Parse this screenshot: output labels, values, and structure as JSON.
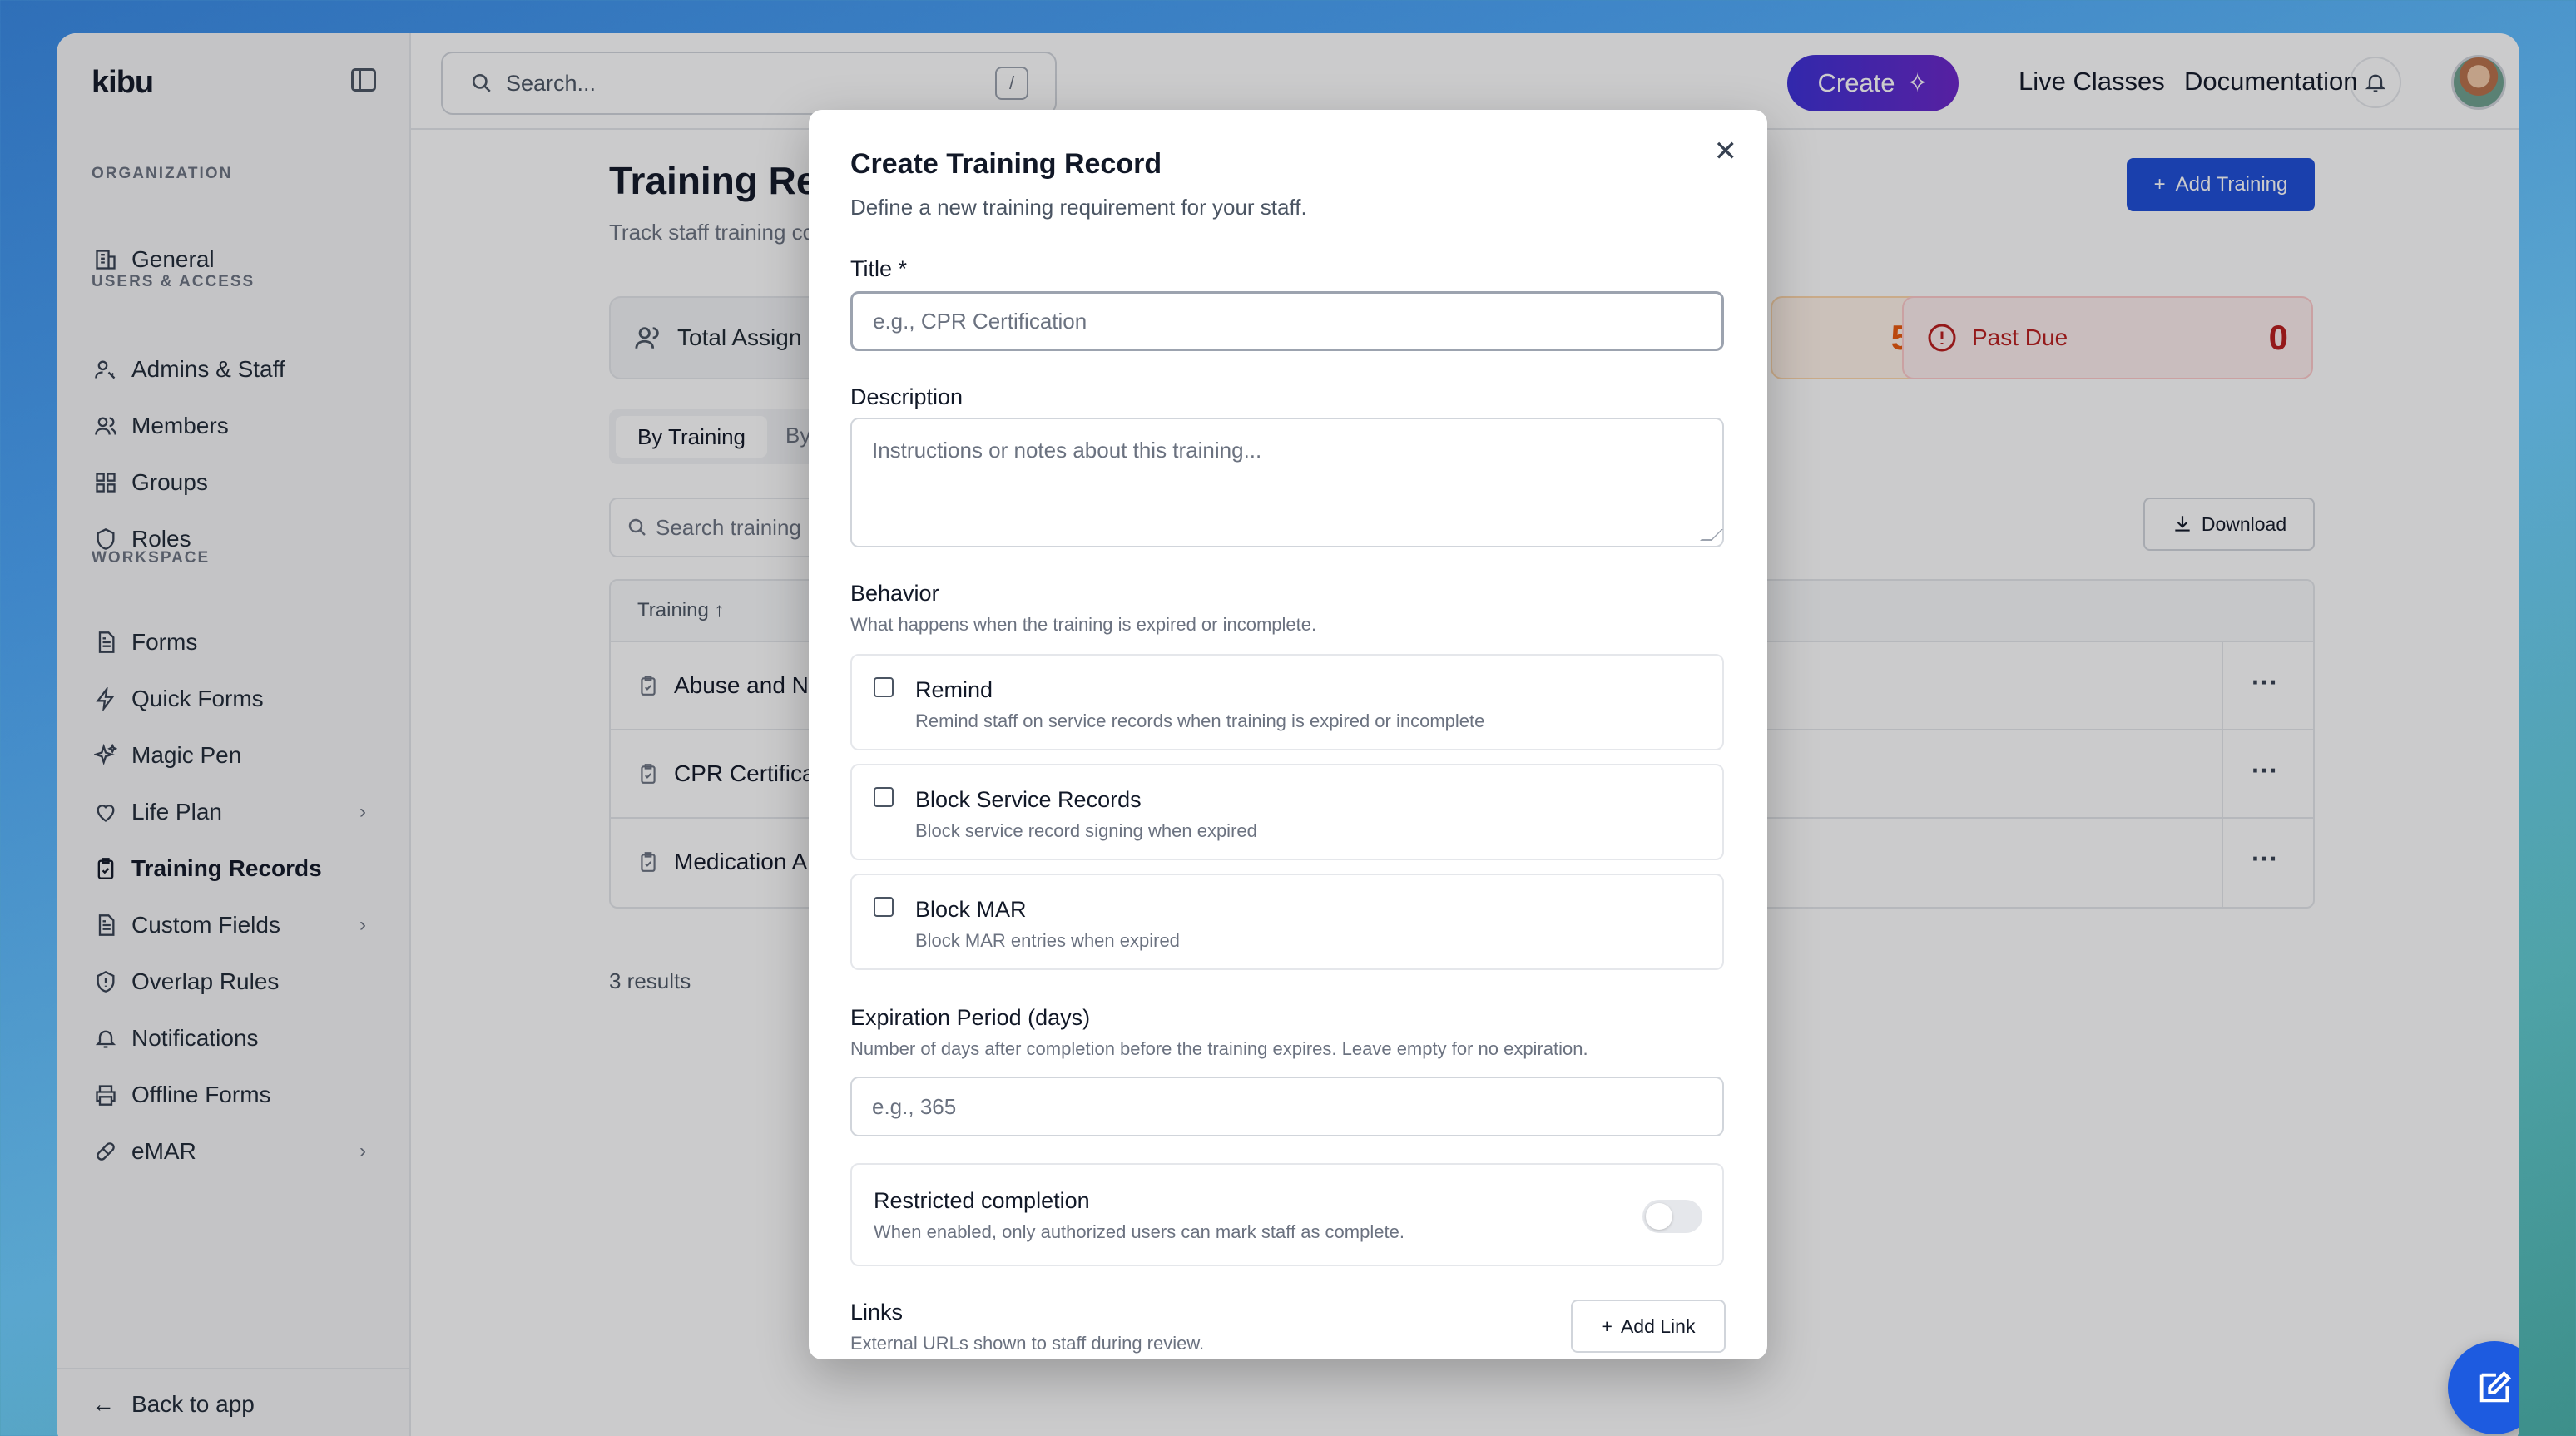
{
  "app": {
    "logo": "kibu"
  },
  "search": {
    "placeholder": "Search...",
    "shortcut": "/"
  },
  "topbar": {
    "create_label": "Create",
    "live_classes": "Live Classes",
    "documentation": "Documentation"
  },
  "sidebar": {
    "sections": {
      "organization": "ORGANIZATION",
      "users_access": "USERS & ACCESS",
      "workspace": "WORKSPACE"
    },
    "items": {
      "general": "General",
      "admins_staff": "Admins & Staff",
      "members": "Members",
      "groups": "Groups",
      "roles": "Roles",
      "forms": "Forms",
      "quick_forms": "Quick Forms",
      "magic_pen": "Magic Pen",
      "life_plan": "Life Plan",
      "training_records": "Training Records",
      "custom_fields": "Custom Fields",
      "overlap_rules": "Overlap Rules",
      "notifications": "Notifications",
      "offline_forms": "Offline Forms",
      "emar": "eMAR"
    },
    "back_to_app": "Back to app"
  },
  "page": {
    "title": "Training Rec",
    "subtitle": "Track staff training co",
    "add_training": "Add Training",
    "stats": {
      "total_label": "Total Assign",
      "orange_value": "5",
      "past_due_label": "Past Due",
      "past_due_value": "0"
    },
    "tabs": {
      "by_training": "By Training",
      "other": "By"
    },
    "table_search_placeholder": "Search training",
    "download": "Download",
    "table": {
      "column_training": "Training",
      "rows": [
        "Abuse and N",
        "CPR Certifica",
        "Medication A"
      ]
    },
    "results": "3 results"
  },
  "modal": {
    "title": "Create Training Record",
    "subtitle": "Define a new training requirement for your staff.",
    "title_label": "Title *",
    "title_placeholder": "e.g., CPR Certification",
    "description_label": "Description",
    "description_placeholder": "Instructions or notes about this training...",
    "behavior_label": "Behavior",
    "behavior_help": "What happens when the training is expired or incomplete.",
    "options": [
      {
        "title": "Remind",
        "desc": "Remind staff on service records when training is expired or incomplete",
        "checked": false
      },
      {
        "title": "Block Service Records",
        "desc": "Block service record signing when expired",
        "checked": false
      },
      {
        "title": "Block MAR",
        "desc": "Block MAR entries when expired",
        "checked": false
      }
    ],
    "expiration_label": "Expiration Period (days)",
    "expiration_help": "Number of days after completion before the training expires. Leave empty for no expiration.",
    "expiration_placeholder": "e.g., 365",
    "restricted_title": "Restricted completion",
    "restricted_desc": "When enabled, only authorized users can mark staff as complete.",
    "restricted_enabled": false,
    "links_label": "Links",
    "links_help": "External URLs shown to staff during review.",
    "add_link": "Add Link"
  },
  "colors": {
    "accent": "#1d4ed8",
    "create_gradient_start": "#3b2fd6",
    "create_gradient_end": "#6a25c9",
    "past_due": "#b91c1c",
    "warning": "#ea580c"
  }
}
